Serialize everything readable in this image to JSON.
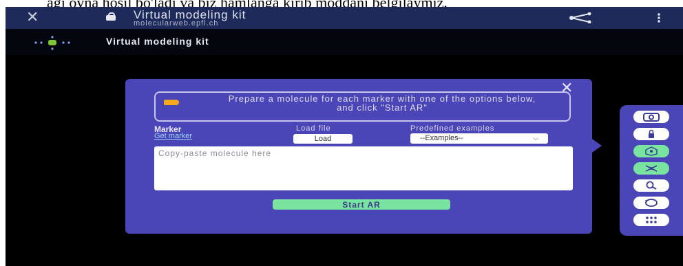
{
  "caption": {
    "text": "agi oyna hosil bo'ladi va biz hamlanga kirib moddani belgilaymiz."
  },
  "appbar": {
    "title": "Virtual modeling kit",
    "url": "molecularweb.epfl.ch",
    "close_icon": "close-icon",
    "lock_icon": "lock-icon",
    "share_icon": "share-icon",
    "menu_icon": "more-vertical-icon"
  },
  "subbar": {
    "title": "Virtual modeling kit",
    "nav_icon": "navigation-dots-icon"
  },
  "panel": {
    "notice": "Prepare a molecule for each marker with one of the options below, and click \"Start AR\"",
    "marker_label": "Marker",
    "get_marker_link": "Get marker",
    "load_file_label": "Load file",
    "load_button": "Load",
    "predefined_label": "Predefined examples",
    "examples_selected": "--Examples--",
    "textarea_placeholder": "Copy-paste molecule here",
    "start_button": "Start AR"
  },
  "toolbar": {
    "tools": [
      {
        "icon": "camera-icon",
        "state": "default"
      },
      {
        "icon": "atom-lock-icon",
        "state": "default"
      },
      {
        "icon": "molecule-build-icon",
        "state": "active"
      },
      {
        "icon": "molecule-link-icon",
        "state": "active"
      },
      {
        "icon": "zoom-icon",
        "state": "default"
      },
      {
        "icon": "rotate-icon",
        "state": "default"
      },
      {
        "icon": "atoms-grid-icon",
        "state": "default"
      }
    ]
  },
  "colors": {
    "appbar": "#1e2b5a",
    "panel": "#4b46b7",
    "accent_green": "#79e4a0",
    "link": "#9fd5ff"
  }
}
